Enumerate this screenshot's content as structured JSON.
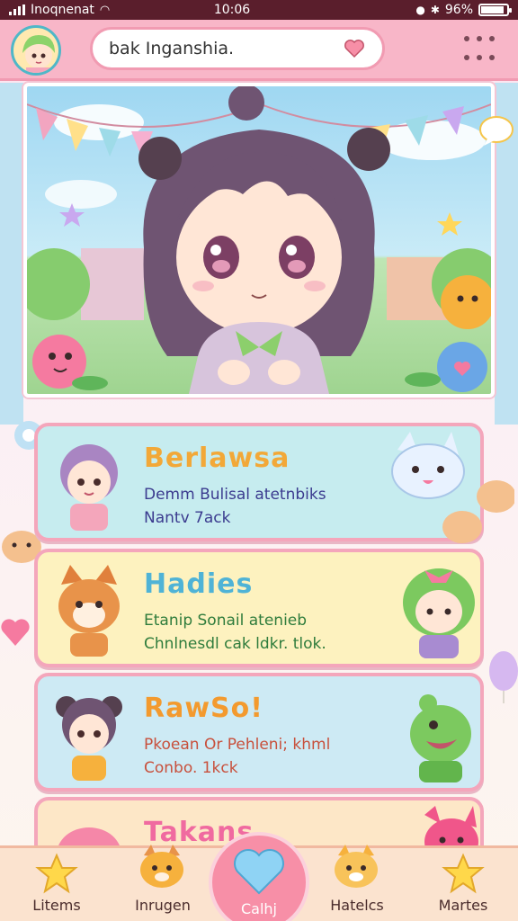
{
  "status_bar": {
    "carrier": "Inoqnenat",
    "time": "10:06",
    "battery": "96%",
    "battery_level": 0.9
  },
  "header": {
    "search_value": "bak Inganshia."
  },
  "cards": [
    {
      "title": "Berlawsa",
      "line1": "Demm Bulisal atetnbiks",
      "line2": "Nantv 7ack",
      "bg": "#c6ecef",
      "title_color": "#f2a838",
      "text_color": "#3b3b8f"
    },
    {
      "title": "Hadies",
      "line1": "Etanip Sonail atenieb",
      "line2": "Chnlnesdl cak ldkr. tlok.",
      "bg": "#fdf2bf",
      "title_color": "#4fb3d6",
      "text_color": "#2f7c3c"
    },
    {
      "title": "RawSo!",
      "line1": "Pkoean Or Pehleni; khml",
      "line2": "Conbo. 1kck",
      "bg": "#cdeaf4",
      "title_color": "#f39a2e",
      "text_color": "#c8503c"
    },
    {
      "title": "Takans",
      "bg": "#fde7c7",
      "title_color": "#f06aa0"
    }
  ],
  "bottom_nav": [
    {
      "label": "Litems",
      "icon": "star-icon"
    },
    {
      "label": "Inrugen",
      "icon": "dog-icon"
    },
    {
      "label": "Calhj",
      "icon": "heart-icon"
    },
    {
      "label": "Hatelcs",
      "icon": "shiba-icon"
    },
    {
      "label": "Martes",
      "icon": "star-icon"
    }
  ],
  "colors": {
    "accent": "#f78fa7",
    "header": "#f8b6c8",
    "status_bar": "#5a1e2c"
  }
}
